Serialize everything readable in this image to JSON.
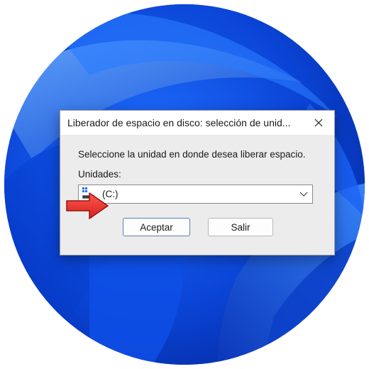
{
  "dialog": {
    "title": "Liberador de espacio en disco: selección de unid...",
    "instruction": "Seleccione la unidad en donde desea liberar espacio.",
    "drives_label": "Unidades:",
    "selected_drive": "(C:)",
    "ok_label": "Aceptar",
    "exit_label": "Salir"
  },
  "icons": {
    "close": "close-icon",
    "drive": "drive-icon",
    "dropdown": "chevron-down-icon",
    "pointer": "red-arrow-icon"
  },
  "colors": {
    "wallpaper_blue": "#0a3fd0",
    "dialog_bg": "#ececec",
    "arrow_red": "#e8322e"
  }
}
